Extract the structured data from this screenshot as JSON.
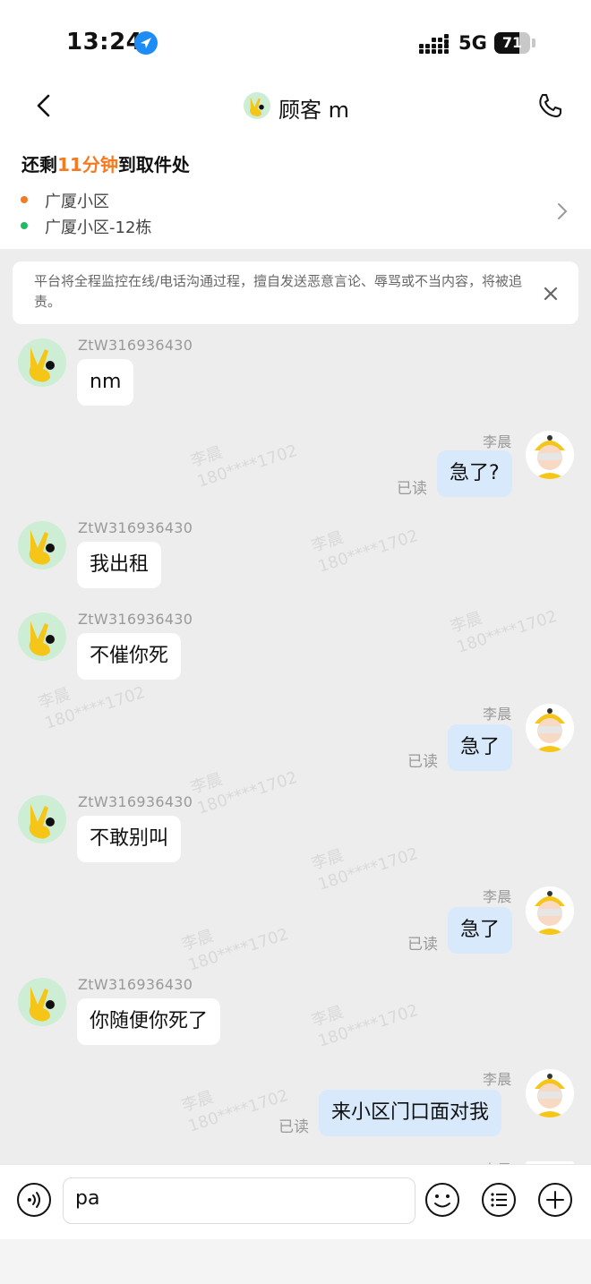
{
  "status_bar": {
    "time": "13:24",
    "network": "5G",
    "battery_percent": 71,
    "battery_label": "71"
  },
  "header": {
    "title": "顾客 m"
  },
  "eta": {
    "prefix": "还剩",
    "minutes": "11分钟",
    "suffix": "到取件处",
    "pickup": "广厦小区",
    "dropoff": "广厦小区-12栋"
  },
  "notice": {
    "text": "平台将全程监控在线/电话沟通过程，擅自发送恶意言论、辱骂或不当内容，将被追责。"
  },
  "watermark": {
    "name": "李晨",
    "phone": "180****1702"
  },
  "messages": [
    {
      "side": "left",
      "sender": "ZtW316936430",
      "text": "nm"
    },
    {
      "side": "right",
      "sender": "李晨",
      "text": "急了?",
      "status": "已读"
    },
    {
      "side": "left",
      "sender": "ZtW316936430",
      "text": "我出租"
    },
    {
      "side": "left",
      "sender": "ZtW316936430",
      "text": "不催你死"
    },
    {
      "side": "right",
      "sender": "李晨",
      "text": "急了",
      "status": "已读"
    },
    {
      "side": "left",
      "sender": "ZtW316936430",
      "text": "不敢别叫"
    },
    {
      "side": "right",
      "sender": "李晨",
      "text": "急了",
      "status": "已读"
    },
    {
      "side": "left",
      "sender": "ZtW316936430",
      "text": "你随便你死了"
    },
    {
      "side": "right",
      "sender": "李晨",
      "text": "来小区门口面对我",
      "status": "已读"
    },
    {
      "side": "right",
      "sender": "李晨",
      "text": ""
    }
  ],
  "composer": {
    "value": "pa"
  },
  "icons": {
    "back": "chevron-left-icon",
    "call": "phone-icon",
    "voice": "voice-icon",
    "emoji": "emoji-icon",
    "more": "list-icon",
    "add": "plus-icon"
  },
  "colors": {
    "accent": "#f57a22",
    "pickup_dot": "#f57a22",
    "dropoff_dot": "#22b866",
    "outgoing_bubble": "#d8e9fb"
  }
}
